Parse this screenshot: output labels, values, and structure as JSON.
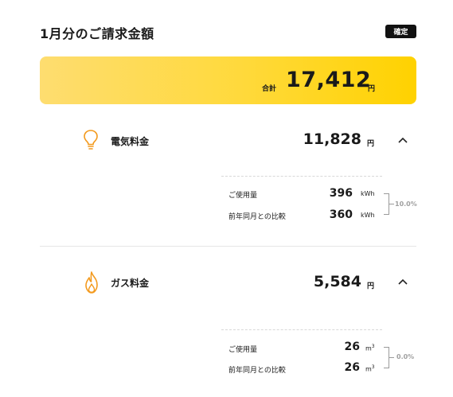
{
  "header": {
    "title": "1月分のご請求金額",
    "status": "確定"
  },
  "total": {
    "label": "合計",
    "value": "17,412",
    "unit": "円"
  },
  "electricity": {
    "title": "電気料金",
    "amount": "11,828",
    "unit": "円",
    "usage_label": "ご使用量",
    "usage_value": "396",
    "usage_unit": "kWh",
    "prev_label": "前年同月との比較",
    "prev_value": "360",
    "prev_unit": "kWh",
    "change_percent": "10.0%"
  },
  "gas": {
    "title": "ガス料金",
    "amount": "5,584",
    "unit": "円",
    "usage_label": "ご使用量",
    "usage_value": "26",
    "usage_unit_base": "m",
    "usage_unit_sup": "3",
    "prev_label": "前年同月との比較",
    "prev_value": "26",
    "prev_unit_base": "m",
    "prev_unit_sup": "3",
    "change_percent": "0.0%"
  },
  "colors": {
    "accent_yellow": "#ffd200",
    "icon_orange": "#f39a1e",
    "badge_bg": "#111111"
  },
  "icons": {
    "electricity": "lightbulb-icon",
    "gas": "flame-icon",
    "toggle": "chevron-up-icon"
  }
}
